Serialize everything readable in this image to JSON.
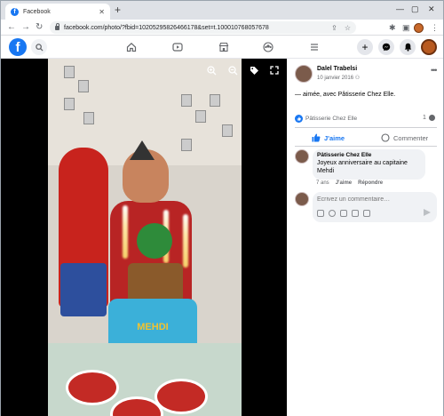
{
  "browser": {
    "tab_title": "Facebook",
    "url": "facebook.com/photo/?fbid=10205295826466178&set=t.100010768057678"
  },
  "post": {
    "author": "Dalel Trabelsi",
    "date": "10 janvier 2016",
    "text_prefix": "— aimée, avec ",
    "text_page": "Pâtisserie Chez Elle",
    "text_suffix": ".",
    "reactor": "Pâtisserie Chez Elle",
    "reaction_count": "1"
  },
  "actions": {
    "like": "J'aime",
    "comment": "Commenter"
  },
  "comment": {
    "author": "Pâtisserie Chez Elle",
    "text": "Joyeux anniversaire au capitaine Mehdi",
    "time": "7 ans",
    "like": "J'aime",
    "reply": "Répondre"
  },
  "composer": {
    "placeholder": "Écrivez un commentaire…"
  },
  "photo": {
    "cake_name": "MEHDI"
  },
  "colors": {
    "brand": "#1877f2",
    "photo_bg": "#000000"
  }
}
